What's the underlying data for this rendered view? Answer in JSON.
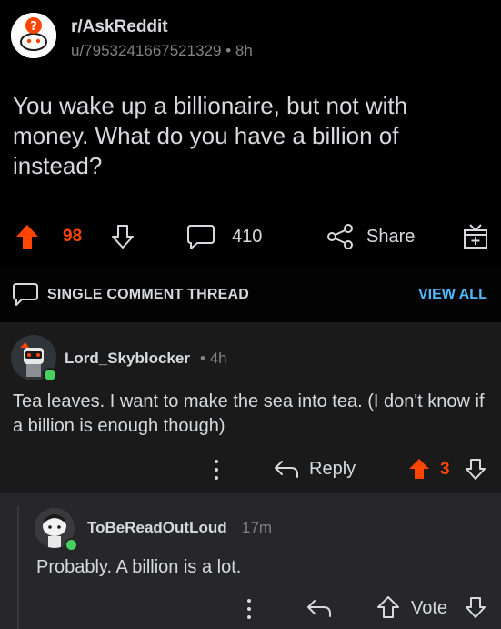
{
  "post": {
    "subreddit": "r/AskReddit",
    "author": "u/7953241667521329",
    "separator": "•",
    "age": "8h",
    "title": "You wake up a billionaire, but not with money. What do you have a billion of instead?",
    "score": "98",
    "comments": "410",
    "share_label": "Share"
  },
  "thread": {
    "label": "SINGLE COMMENT THREAD",
    "view_all": "VIEW ALL"
  },
  "comments": [
    {
      "user": "Lord_Skyblocker",
      "separator": "•",
      "age": "4h",
      "body": "Tea leaves. I want to make the sea into tea. (I don't know if a billion is enough though)",
      "reply_label": "Reply",
      "score": "3"
    },
    {
      "user": "ToBeReadOutLoud",
      "age": "17m",
      "body": "Probably. A billion is a lot.",
      "vote_label": "Vote"
    }
  ],
  "colors": {
    "upvote_active": "#ff4500",
    "link": "#4fbcff",
    "online": "#46d160"
  }
}
